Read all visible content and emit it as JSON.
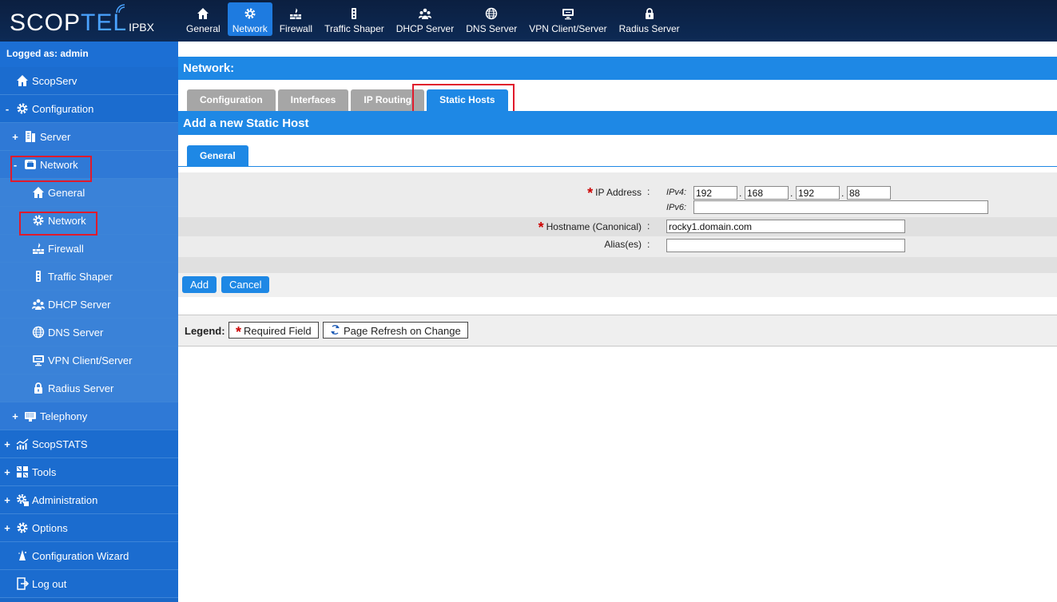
{
  "logo": {
    "scop": "SCOP",
    "tel": "TEL",
    "ipbx": "IPBX"
  },
  "topnav": [
    {
      "label": "General",
      "icon": "home-icon"
    },
    {
      "label": "Network",
      "icon": "gear-icon",
      "active": true
    },
    {
      "label": "Firewall",
      "icon": "firewall-icon"
    },
    {
      "label": "Traffic Shaper",
      "icon": "traffic-light-icon"
    },
    {
      "label": "DHCP Server",
      "icon": "users-icon"
    },
    {
      "label": "DNS Server",
      "icon": "globe-icon"
    },
    {
      "label": "VPN Client/Server",
      "icon": "monitor-icon"
    },
    {
      "label": "Radius Server",
      "icon": "lock-icon"
    }
  ],
  "sidebar": {
    "user": "Logged as: admin",
    "items": [
      {
        "label": "ScopServ",
        "pm": "",
        "icon": "home-icon"
      },
      {
        "label": "Configuration",
        "pm": "-",
        "icon": "gear-icon"
      },
      {
        "label": "Server",
        "pm": "+",
        "icon": "server-icon"
      },
      {
        "label": "Network",
        "pm": "-",
        "icon": "network-icon"
      },
      {
        "label": "General",
        "pm": "",
        "icon": "home-icon"
      },
      {
        "label": "Network",
        "pm": "",
        "icon": "gear-icon"
      },
      {
        "label": "Firewall",
        "pm": "",
        "icon": "firewall-icon"
      },
      {
        "label": "Traffic Shaper",
        "pm": "",
        "icon": "traffic-light-icon"
      },
      {
        "label": "DHCP Server",
        "pm": "",
        "icon": "users-icon"
      },
      {
        "label": "DNS Server",
        "pm": "",
        "icon": "globe-icon"
      },
      {
        "label": "VPN Client/Server",
        "pm": "",
        "icon": "monitor-icon"
      },
      {
        "label": "Radius Server",
        "pm": "",
        "icon": "lock-icon"
      },
      {
        "label": "Telephony",
        "pm": "+",
        "icon": "phone-icon"
      },
      {
        "label": "ScopSTATS",
        "pm": "+",
        "icon": "stats-icon"
      },
      {
        "label": "Tools",
        "pm": "+",
        "icon": "tools-icon"
      },
      {
        "label": "Administration",
        "pm": "+",
        "icon": "admin-gear-icon"
      },
      {
        "label": "Options",
        "pm": "+",
        "icon": "gear-icon"
      },
      {
        "label": "Configuration Wizard",
        "pm": "",
        "icon": "wizard-icon"
      },
      {
        "label": "Log out",
        "pm": "",
        "icon": "logout-icon"
      }
    ]
  },
  "main": {
    "title": "Network:",
    "tabs": [
      "Configuration",
      "Interfaces",
      "IP Routing",
      "Static Hosts"
    ],
    "active_tab": "Static Hosts",
    "section_title": "Add a new Static Host",
    "subtab": "General",
    "form": {
      "ip_label": "IP Address",
      "ipv4_label": "IPv4:",
      "ipv6_label": "IPv6:",
      "ipv4": [
        "192",
        "168",
        "192",
        "88"
      ],
      "ipv6": "",
      "hostname_label": "Hostname (Canonical)",
      "hostname": "rocky1.domain.com",
      "alias_label": "Alias(es)",
      "alias": "",
      "colon": ":",
      "dot": ".",
      "required_mark": "*"
    },
    "buttons": {
      "add": "Add",
      "cancel": "Cancel"
    },
    "legend": {
      "title": "Legend:",
      "required": "Required Field",
      "refresh": "Page Refresh on Change"
    }
  },
  "colors": {
    "topbar": "#0d2a55",
    "accent": "#1e88e5",
    "sidebar": "#1b6ccf",
    "highlight": "#e01a2c"
  }
}
